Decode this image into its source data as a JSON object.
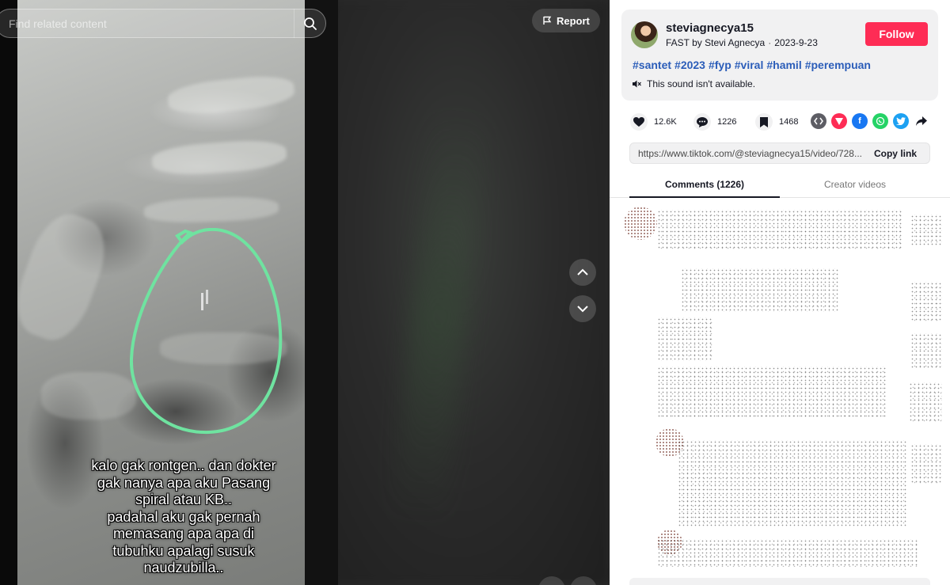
{
  "search": {
    "placeholder": "Find related content"
  },
  "video": {
    "report_label": "Report",
    "caption_lines": [
      "kalo gak rontgen.. dan dokter",
      "gak nanya apa aku Pasang",
      "spiral atau KB..",
      "padahal aku gak pernah",
      "memasang apa apa di",
      "tubuhku apalagi susuk",
      "naudzubilla.."
    ],
    "annotation_color": "#6fe3a0"
  },
  "author": {
    "username": "steviagnecya15",
    "sound_label": "FAST by Stevi Agnecya",
    "date": "2023-9-23",
    "follow_label": "Follow"
  },
  "description": {
    "hashtags": [
      "#santet",
      "#2023",
      "#fyp",
      "#viral",
      "#hamil",
      "#perempuan"
    ],
    "sound_status": "This sound isn't available."
  },
  "stats": {
    "likes": "12.6K",
    "comments": "1226",
    "saves": "1468"
  },
  "share": {
    "icons": [
      "embed-icon",
      "send-icon",
      "facebook-icon",
      "whatsapp-icon",
      "twitter-icon",
      "share-arrow-icon"
    ]
  },
  "link": {
    "url": "https://www.tiktok.com/@steviagnecya15/video/728...",
    "copy_label": "Copy link"
  },
  "tabs": {
    "comments_label": "Comments (1226)",
    "creator_label": "Creator videos"
  },
  "colors": {
    "follow": "#fe2c55",
    "hashtag": "#2b5db9",
    "accent_text": "#161823"
  }
}
